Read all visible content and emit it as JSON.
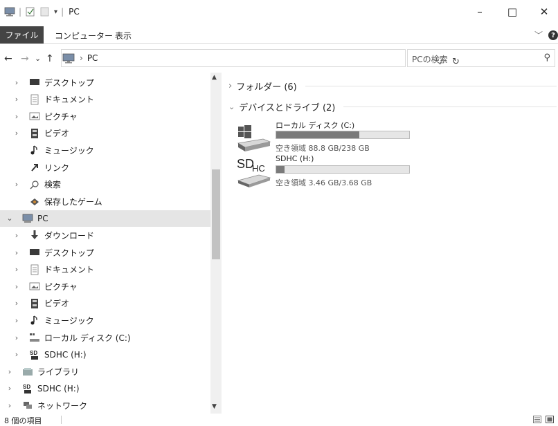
{
  "window": {
    "title": "PC",
    "controls": {
      "minimize": "–",
      "maximize": "□",
      "close": "✕"
    }
  },
  "ribbon": {
    "tabs": [
      "ファイル",
      "コンピューター",
      "表示"
    ],
    "expand_chevron": "﹀",
    "help": "?"
  },
  "address": {
    "back": "←",
    "forward": "→",
    "recent": "⌄",
    "up": "↑",
    "path": [
      "PC"
    ],
    "dropdown": "⌄",
    "refresh": "↻"
  },
  "search": {
    "placeholder": "PCの検索",
    "icon": "search-icon"
  },
  "nav": {
    "items": [
      {
        "label": "デスクトップ",
        "icon": "desktop-icon",
        "arrow": "›"
      },
      {
        "label": "ドキュメント",
        "icon": "document-icon",
        "arrow": "›"
      },
      {
        "label": "ピクチャ",
        "icon": "pictures-icon",
        "arrow": "›"
      },
      {
        "label": "ビデオ",
        "icon": "video-icon",
        "arrow": "›"
      },
      {
        "label": "ミュージック",
        "icon": "music-icon",
        "arrow": ""
      },
      {
        "label": "リンク",
        "icon": "link-icon",
        "arrow": ""
      },
      {
        "label": "検索",
        "icon": "search-icon",
        "arrow": "›"
      },
      {
        "label": "保存したゲーム",
        "icon": "saved-games-icon",
        "arrow": ""
      },
      {
        "label": "PC",
        "icon": "pc-icon",
        "arrow": "⌄"
      },
      {
        "label": "ダウンロード",
        "icon": "download-icon",
        "arrow": "›"
      },
      {
        "label": "デスクトップ",
        "icon": "desktop-icon",
        "arrow": "›"
      },
      {
        "label": "ドキュメント",
        "icon": "document-icon",
        "arrow": "›"
      },
      {
        "label": "ピクチャ",
        "icon": "pictures-icon",
        "arrow": "›"
      },
      {
        "label": "ビデオ",
        "icon": "video-icon",
        "arrow": "›"
      },
      {
        "label": "ミュージック",
        "icon": "music-icon",
        "arrow": "›"
      },
      {
        "label": "ローカル ディスク (C:)",
        "icon": "local-disk-icon",
        "arrow": "›"
      },
      {
        "label": "SDHC (H:)",
        "icon": "sd-card-icon",
        "arrow": "›"
      },
      {
        "label": "ライブラリ",
        "icon": "library-icon",
        "arrow": "›"
      },
      {
        "label": "SDHC (H:)",
        "icon": "sd-card-icon",
        "arrow": "›"
      },
      {
        "label": "ネットワーク",
        "icon": "network-icon",
        "arrow": "›"
      }
    ],
    "selected_index": 8
  },
  "content": {
    "folders_group": "フォルダー (6)",
    "drives_group": "デバイスとドライブ (2)",
    "drives": [
      {
        "name": "ローカル ディスク (C:)",
        "free": "空き領域 88.8 GB/238 GB",
        "used_fraction": 0.627,
        "icon": "windows-drive-icon"
      },
      {
        "name": "SDHC (H:)",
        "free": "空き領域 3.46 GB/3.68 GB",
        "used_fraction": 0.06,
        "icon": "sd-drive-icon"
      }
    ],
    "sd_logo_text": "SD",
    "sd_logo_sub": "HC"
  },
  "status": {
    "item_count": "8 個の項目"
  },
  "colors": {
    "file_tab": "#444444",
    "selection": "#e5e5e5",
    "drive_fill": "#7a7a7a"
  }
}
